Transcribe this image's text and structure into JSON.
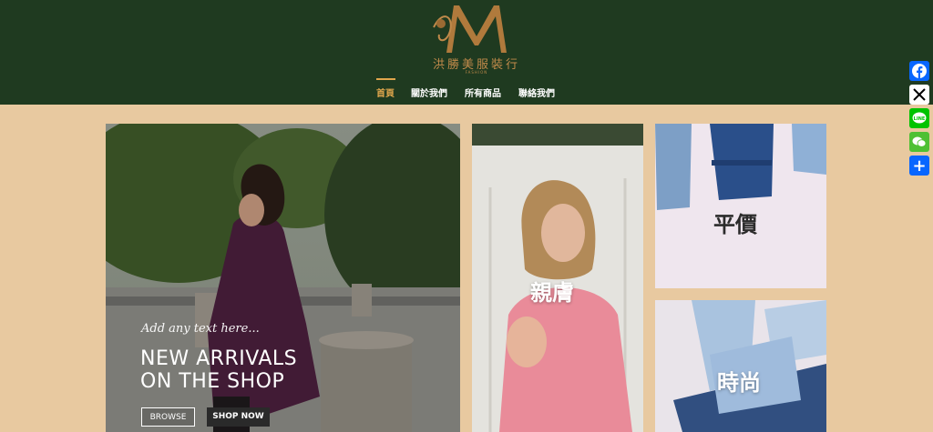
{
  "header": {
    "brand_name": "洪勝美服裝行",
    "brand_sub": "FASHION",
    "logo_letter": "M"
  },
  "nav": {
    "items": [
      {
        "label": "首頁",
        "active": true
      },
      {
        "label": "關於我們",
        "active": false
      },
      {
        "label": "所有商品",
        "active": false
      },
      {
        "label": "聯絡我們",
        "active": false
      }
    ]
  },
  "share": {
    "facebook": "facebook-icon",
    "x": "x-icon",
    "line": "line-icon",
    "wechat": "wechat-icon",
    "more": "plus-icon",
    "colors": {
      "facebook": "#0866ff",
      "x": "#000000",
      "line": "#00c300",
      "wechat": "#4ec034",
      "more": "#0866ff"
    }
  },
  "hero": {
    "tagline": "Add any text here...",
    "title_line1": "NEW ARRIVALS",
    "title_line2": "ON THE SHOP",
    "browse_label": "BROWSE",
    "shop_label": "SHOP NOW"
  },
  "tiles": {
    "middle_label": "親膚",
    "right_top_label": "平價",
    "right_bottom_label": "時尚"
  },
  "colors": {
    "header_bg": "#1f3a20",
    "page_bg": "#e8c9a0",
    "accent": "#e0a64c"
  }
}
